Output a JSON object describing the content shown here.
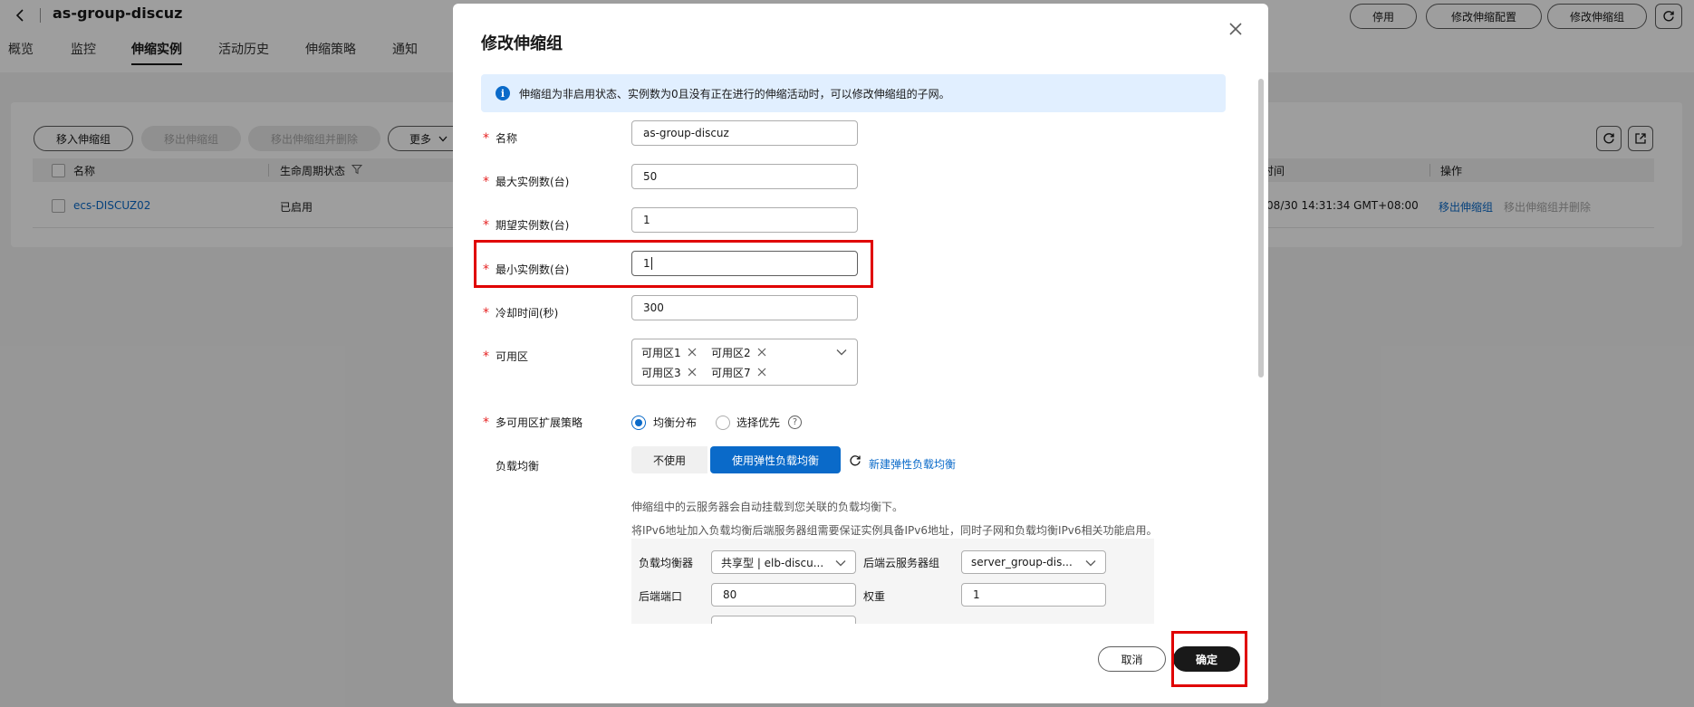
{
  "page": {
    "group_name": "as-group-discuz",
    "tabs": [
      "概览",
      "监控",
      "伸缩实例",
      "活动历史",
      "伸缩策略",
      "通知"
    ],
    "active_tab": "伸缩实例",
    "top_buttons": {
      "disable": "停用",
      "modify_config": "修改伸缩配置",
      "modify_group": "修改伸缩组"
    },
    "toolbar": {
      "move_in": "移入伸缩组",
      "move_out": "移出伸缩组",
      "move_out_delete": "移出伸缩组并删除",
      "more": "更多"
    },
    "table": {
      "headers": {
        "name": "名称",
        "lifecycle": "生命周期状态",
        "time": "时间",
        "actions": "操作"
      },
      "rows": [
        {
          "name": "ecs-DISCUZ02",
          "lifecycle": "已启用",
          "time": "/08/30 14:31:34 GMT+08:00",
          "action_move_out": "移出伸缩组",
          "action_move_out_delete": "移出伸缩组并删除"
        }
      ]
    }
  },
  "modal": {
    "title": "修改伸缩组",
    "info": "伸缩组为非启用状态、实例数为0且没有正在进行的伸缩活动时，可以修改伸缩组的子网。",
    "fields": {
      "name": {
        "label": "名称",
        "value": "as-group-discuz"
      },
      "max": {
        "label": "最大实例数(台)",
        "value": "50"
      },
      "desired": {
        "label": "期望实例数(台)",
        "value": "1"
      },
      "min": {
        "label": "最小实例数(台)",
        "value": "1"
      },
      "cooldown": {
        "label": "冷却时间(秒)",
        "value": "300"
      },
      "az": {
        "label": "可用区",
        "tags": [
          "可用区1",
          "可用区2",
          "可用区3",
          "可用区7"
        ]
      },
      "strategy": {
        "label": "多可用区扩展策略",
        "options": [
          "均衡分布",
          "选择优先"
        ],
        "selected": "均衡分布"
      },
      "lb": {
        "label": "负载均衡",
        "options": [
          "不使用",
          "使用弹性负载均衡"
        ],
        "selected": "使用弹性负载均衡",
        "create_link": "新建弹性负载均衡",
        "hint1": "伸缩组中的云服务器会自动挂载到您关联的负载均衡下。",
        "hint2": "将IPv6地址加入负载均衡后端服务器组需要保证实例具备IPv6地址，同时子网和负载均衡IPv6相关功能启用。",
        "balancer_label": "负载均衡器",
        "balancer_value": "共享型 | elb-discu...",
        "server_group_label": "后端云服务器组",
        "server_group_value": "server_group-dis...",
        "port_label": "后端端口",
        "port_value": "80",
        "weight_label": "权重",
        "weight_value": "1"
      }
    },
    "buttons": {
      "cancel": "取消",
      "ok": "确定"
    }
  },
  "colors": {
    "primary": "#0a6ac9",
    "required": "#e62424",
    "highlight": "#e00000",
    "info_bg": "#e1efff"
  }
}
